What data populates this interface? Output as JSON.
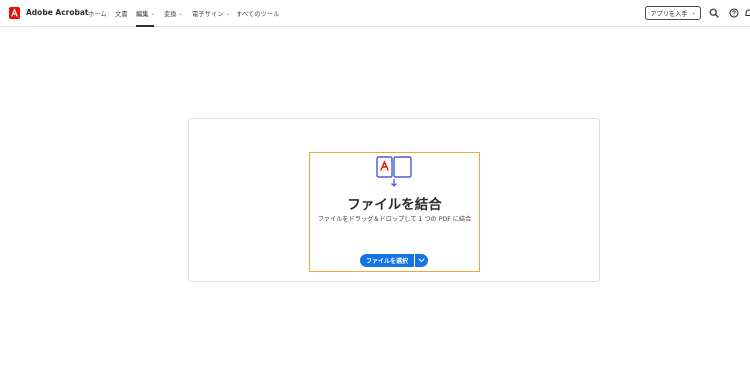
{
  "app": {
    "name": "Adobe Acrobat",
    "brand_color": "#eb1000"
  },
  "nav": {
    "items": [
      {
        "label": "ホーム",
        "has_dropdown": false
      },
      {
        "label": "文書",
        "has_dropdown": false
      },
      {
        "label": "編集",
        "has_dropdown": true,
        "active": true
      },
      {
        "label": "変換",
        "has_dropdown": true
      },
      {
        "label": "電子サイン",
        "has_dropdown": true
      },
      {
        "label": "すべてのツール",
        "has_dropdown": false
      }
    ]
  },
  "toolbar": {
    "get_app_label": "アプリを入手",
    "icons": [
      "search-icon",
      "help-icon",
      "notifications-icon"
    ]
  },
  "dropzone": {
    "title": "ファイルを結合",
    "subtitle": "ファイルをドラッグ＆ドロップして 1 つの PDF に結合",
    "select_button_label": "ファイルを選択",
    "border_color": "#f5a63a",
    "accent_color": "#1473e6"
  }
}
